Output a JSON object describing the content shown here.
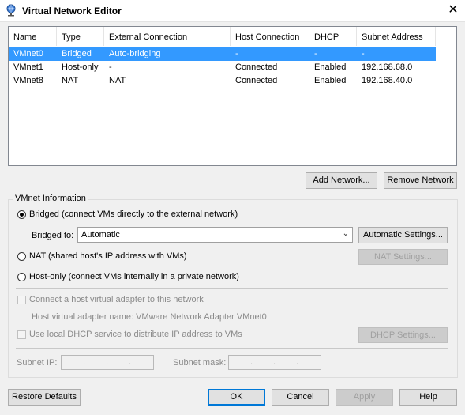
{
  "window": {
    "title": "Virtual Network Editor",
    "close_glyph": "✕",
    "icon": "network-globe-icon"
  },
  "table": {
    "columns": [
      "Name",
      "Type",
      "External Connection",
      "Host Connection",
      "DHCP",
      "Subnet Address"
    ],
    "rows": [
      {
        "name": "VMnet0",
        "type": "Bridged",
        "external": "Auto-bridging",
        "host": "-",
        "dhcp": "-",
        "subnet": "-",
        "selected": true
      },
      {
        "name": "VMnet1",
        "type": "Host-only",
        "external": "-",
        "host": "Connected",
        "dhcp": "Enabled",
        "subnet": "192.168.68.0",
        "selected": false
      },
      {
        "name": "VMnet8",
        "type": "NAT",
        "external": "NAT",
        "host": "Connected",
        "dhcp": "Enabled",
        "subnet": "192.168.40.0",
        "selected": false
      }
    ]
  },
  "buttons": {
    "add_network": "Add Network...",
    "remove_network": "Remove Network",
    "automatic_settings": "Automatic Settings...",
    "nat_settings": "NAT Settings...",
    "dhcp_settings": "DHCP Settings...",
    "restore_defaults": "Restore Defaults",
    "ok": "OK",
    "cancel": "Cancel",
    "apply": "Apply",
    "help": "Help"
  },
  "vmnet_info": {
    "group_label": "VMnet Information",
    "radio_bridged": "Bridged (connect VMs directly to the external network)",
    "bridged_to_label": "Bridged to:",
    "bridged_to_value": "Automatic",
    "radio_nat": "NAT (shared host's IP address with VMs)",
    "radio_hostonly": "Host-only (connect VMs internally in a private network)",
    "selected_mode": "bridged",
    "connect_adapter": "Connect a host virtual adapter to this network",
    "adapter_name": "Host virtual adapter name: VMware Network Adapter VMnet0",
    "use_dhcp": "Use local DHCP service to distribute IP address to VMs",
    "subnet_ip_label": "Subnet IP:",
    "subnet_mask_label": "Subnet mask:"
  },
  "colors": {
    "selection": "#3399ff",
    "default_button_border": "#0078d7",
    "disabled_text": "#8a8a8a"
  }
}
